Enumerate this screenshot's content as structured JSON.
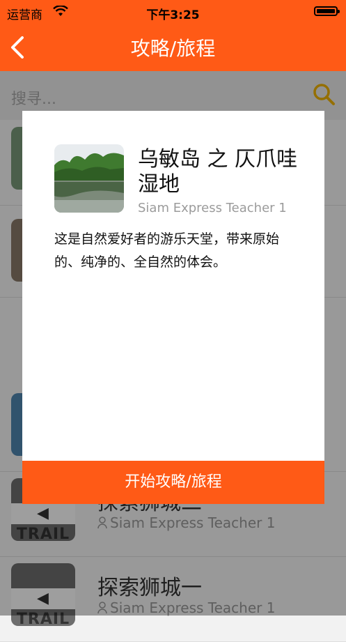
{
  "status_bar": {
    "carrier": "运营商",
    "time": "下午3:25"
  },
  "nav": {
    "title": "攻略/旅程",
    "back_icon": "chevron-left-icon"
  },
  "search": {
    "placeholder": "搜寻...",
    "icon": "search-icon"
  },
  "list": {
    "items": [
      {
        "title": "探索狮城二",
        "author": "Siam Express Teacher 1"
      },
      {
        "title": "探索狮城一",
        "author": "Siam Express Teacher 1"
      }
    ]
  },
  "dialog": {
    "title": "乌敏岛 之 仄爪哇湿地",
    "author": "Siam Express Teacher 1",
    "description": "这是自然爱好者的游乐天堂，带来原始的、纯净的、全自然的体会。",
    "start_button": "开始攻略/旅程"
  },
  "colors": {
    "accent": "#ff5a16",
    "overlay": "rgba(0,0,0,0.38)"
  }
}
